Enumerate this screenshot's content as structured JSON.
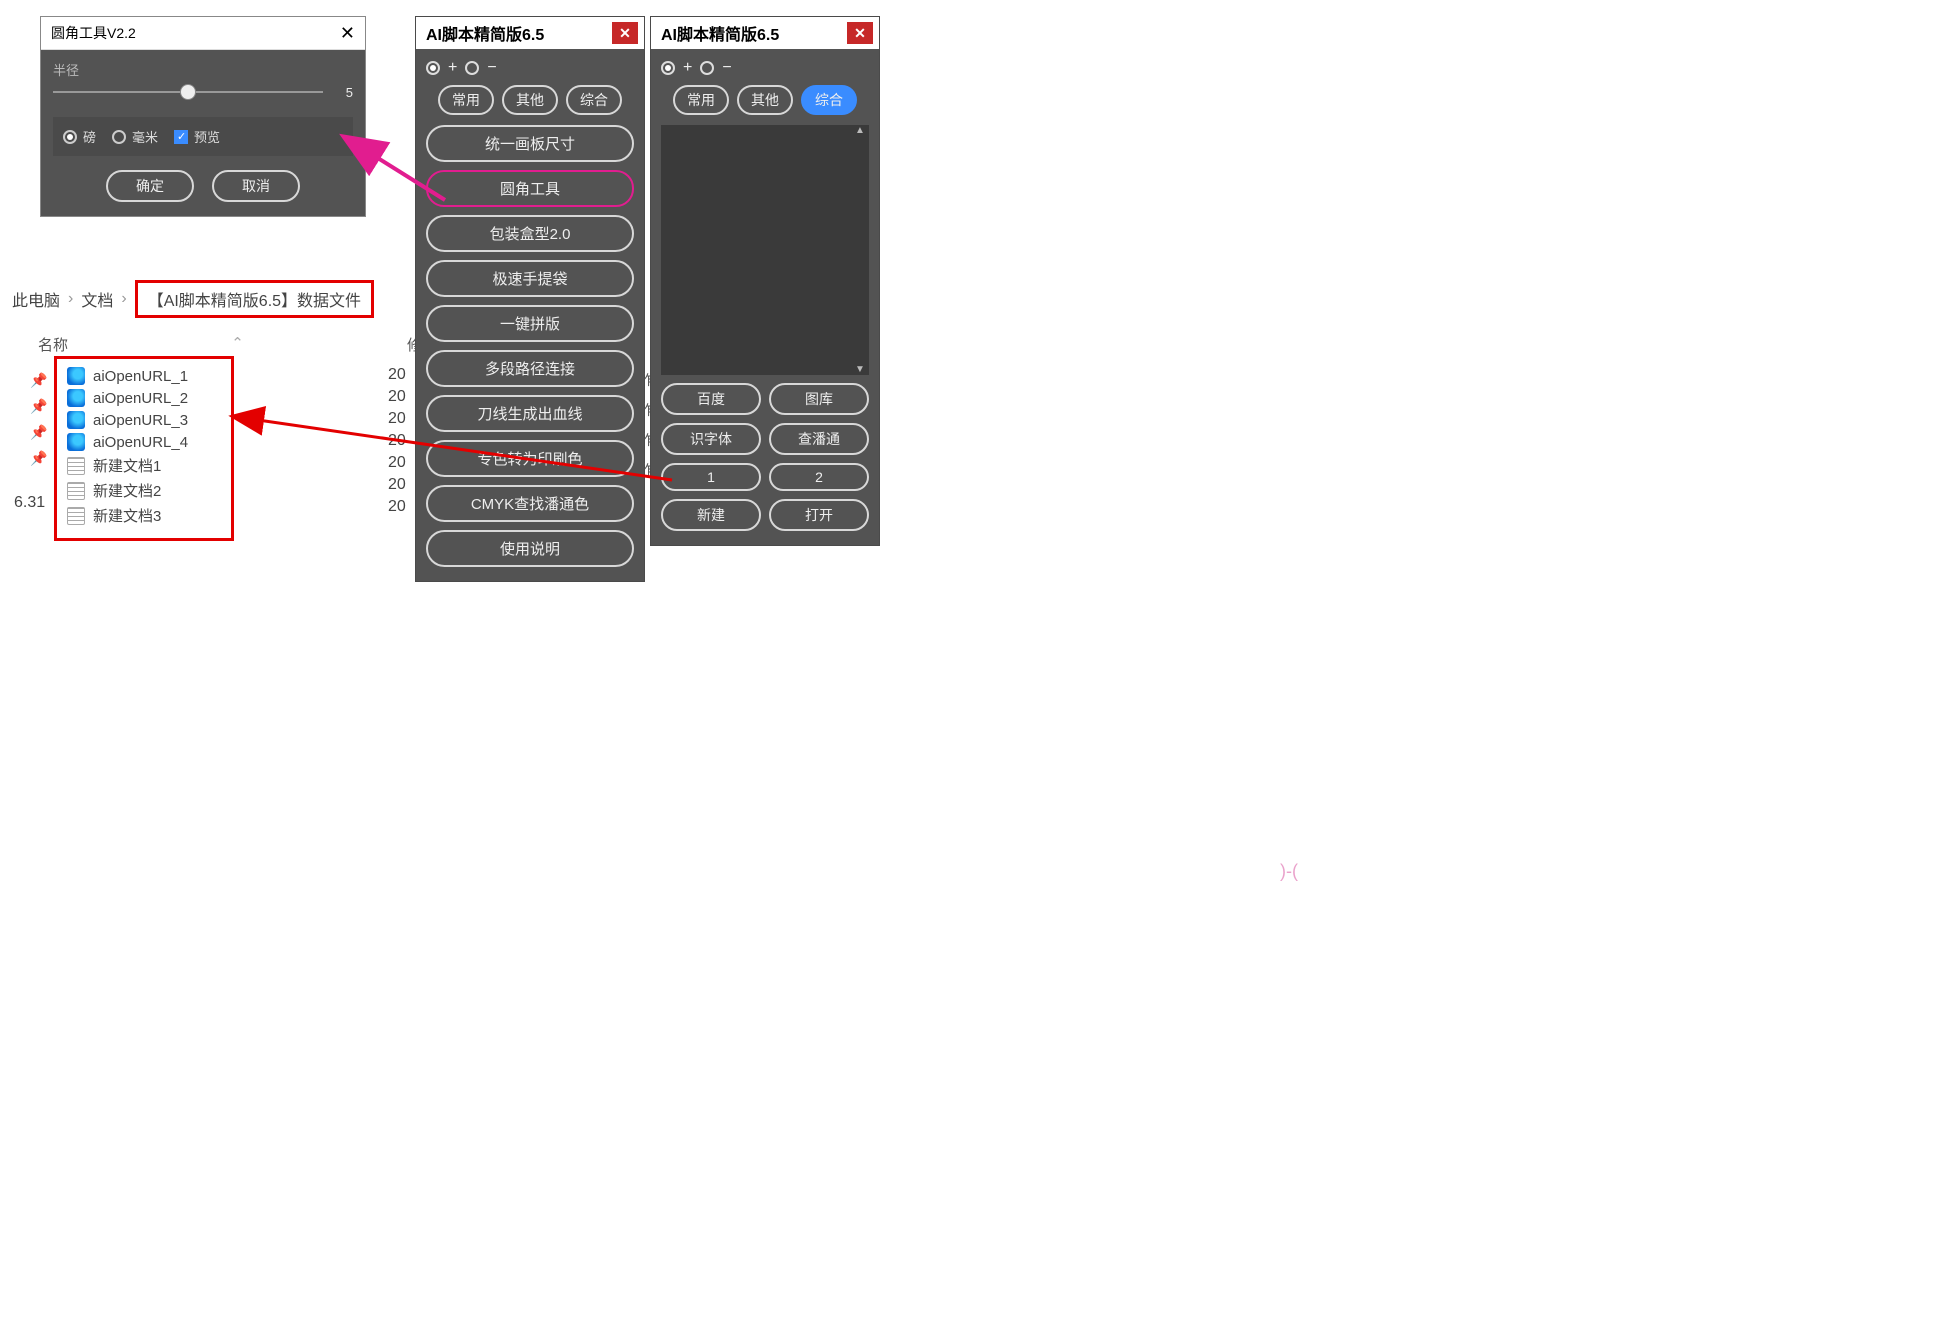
{
  "dialog": {
    "title": "圆角工具V2.2",
    "radius_label": "半径",
    "radius_value": "5",
    "unit_pt": "磅",
    "unit_mm": "毫米",
    "preview": "预览",
    "ok": "确定",
    "cancel": "取消"
  },
  "explorer": {
    "root": "此电脑",
    "docs": "文档",
    "folder": "【AI脚本精简版6.5】数据文件",
    "col_name": "名称",
    "col_mod": "修",
    "version_row": "6.31",
    "files": [
      {
        "name": "aiOpenURL_1",
        "icon": "edge"
      },
      {
        "name": "aiOpenURL_2",
        "icon": "edge"
      },
      {
        "name": "aiOpenURL_3",
        "icon": "edge"
      },
      {
        "name": "aiOpenURL_4",
        "icon": "edge"
      },
      {
        "name": "新建文档1",
        "icon": "doc"
      },
      {
        "name": "新建文档2",
        "icon": "doc"
      },
      {
        "name": "新建文档3",
        "icon": "doc"
      }
    ],
    "partial": [
      "20",
      "20",
      "20",
      "20",
      "20",
      "20",
      "20"
    ]
  },
  "panel_a": {
    "title": "AI脚本精简版6.5",
    "plus": "+",
    "minus": "−",
    "cats": [
      "常用",
      "其他",
      "综合"
    ],
    "buttons": [
      "统一画板尺寸",
      "圆角工具",
      "包装盒型2.0",
      "极速手提袋",
      "一键拼版",
      "多段路径连接",
      "刀线生成出血线",
      "专色转为印刷色",
      "CMYK查找潘通色",
      "使用说明"
    ]
  },
  "panel_b": {
    "title": "AI脚本精简版6.5",
    "plus": "+",
    "minus": "−",
    "cats": [
      "常用",
      "其他",
      "综合"
    ],
    "grid": [
      "百度",
      "图库",
      "识字体",
      "查潘通",
      "1",
      "2",
      "新建",
      "打开"
    ]
  },
  "edge_chars": [
    "作",
    "作",
    "作",
    "作"
  ]
}
